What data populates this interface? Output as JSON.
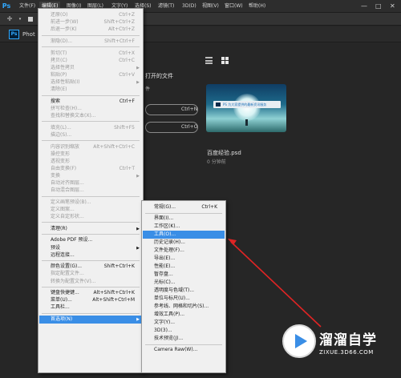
{
  "menubar": {
    "logo": "Ps",
    "items": [
      {
        "label": "文件(F)",
        "active": false
      },
      {
        "label": "编辑(E)",
        "active": true
      },
      {
        "label": "图像(I)",
        "active": false
      },
      {
        "label": "图层(L)",
        "active": false
      },
      {
        "label": "文字(Y)",
        "active": false
      },
      {
        "label": "选择(S)",
        "active": false
      },
      {
        "label": "滤镜(T)",
        "active": false
      },
      {
        "label": "3D(D)",
        "active": false
      },
      {
        "label": "视图(V)",
        "active": false
      },
      {
        "label": "窗口(W)",
        "active": false
      },
      {
        "label": "帮助(H)",
        "active": false
      }
    ],
    "window_controls": [
      "—",
      "□",
      "✕"
    ]
  },
  "tab": {
    "badge": "Ps",
    "label": "Phot"
  },
  "home": {
    "recent_title": "打开的文件",
    "recent_sub": "件",
    "new_shortcut": "Ctrl+N",
    "open_shortcut": "Ctrl+O",
    "file_name": "百度经验.psd",
    "file_time": "0 分钟前",
    "thumb_search_text": "PS 为大家提供的最新资讯服务"
  },
  "edit_menu": {
    "items": [
      {
        "type": "item",
        "label": "还原(O)",
        "shortcut": "Ctrl+Z",
        "disabled": true
      },
      {
        "type": "item",
        "label": "前进一步(W)",
        "shortcut": "Shift+Ctrl+Z",
        "disabled": true
      },
      {
        "type": "item",
        "label": "后退一步(K)",
        "shortcut": "Alt+Ctrl+Z",
        "disabled": true
      },
      {
        "type": "sep"
      },
      {
        "type": "item",
        "label": "渐隐(D)...",
        "shortcut": "Shift+Ctrl+F",
        "disabled": true
      },
      {
        "type": "sep"
      },
      {
        "type": "item",
        "label": "剪切(T)",
        "shortcut": "Ctrl+X",
        "disabled": true
      },
      {
        "type": "item",
        "label": "拷贝(C)",
        "shortcut": "Ctrl+C",
        "disabled": true
      },
      {
        "type": "item",
        "label": "选择性拷贝",
        "shortcut": "",
        "disabled": true,
        "submenu": true
      },
      {
        "type": "item",
        "label": "粘贴(P)",
        "shortcut": "Ctrl+V",
        "disabled": true
      },
      {
        "type": "item",
        "label": "选择性粘贴(I)",
        "shortcut": "",
        "disabled": true,
        "submenu": true
      },
      {
        "type": "item",
        "label": "清除(E)",
        "shortcut": "",
        "disabled": true
      },
      {
        "type": "sep"
      },
      {
        "type": "item",
        "label": "搜索",
        "shortcut": "Ctrl+F",
        "disabled": false
      },
      {
        "type": "item",
        "label": "拼写检查(H)...",
        "shortcut": "",
        "disabled": true
      },
      {
        "type": "item",
        "label": "查找和替换文本(X)...",
        "shortcut": "",
        "disabled": true
      },
      {
        "type": "sep"
      },
      {
        "type": "item",
        "label": "填充(L)...",
        "shortcut": "Shift+F5",
        "disabled": true
      },
      {
        "type": "item",
        "label": "描边(S)...",
        "shortcut": "",
        "disabled": true
      },
      {
        "type": "sep"
      },
      {
        "type": "item",
        "label": "内容识别缩放",
        "shortcut": "Alt+Shift+Ctrl+C",
        "disabled": true
      },
      {
        "type": "item",
        "label": "操控变形",
        "shortcut": "",
        "disabled": true
      },
      {
        "type": "item",
        "label": "透视变形",
        "shortcut": "",
        "disabled": true
      },
      {
        "type": "item",
        "label": "自由变换(F)",
        "shortcut": "Ctrl+T",
        "disabled": true
      },
      {
        "type": "item",
        "label": "变换",
        "shortcut": "",
        "disabled": true,
        "submenu": true
      },
      {
        "type": "item",
        "label": "自动对齐图层...",
        "shortcut": "",
        "disabled": true
      },
      {
        "type": "item",
        "label": "自动混合图层...",
        "shortcut": "",
        "disabled": true
      },
      {
        "type": "sep"
      },
      {
        "type": "item",
        "label": "定义画笔预设(B)...",
        "shortcut": "",
        "disabled": true
      },
      {
        "type": "item",
        "label": "定义图案...",
        "shortcut": "",
        "disabled": true
      },
      {
        "type": "item",
        "label": "定义自定形状...",
        "shortcut": "",
        "disabled": true
      },
      {
        "type": "sep"
      },
      {
        "type": "item",
        "label": "清理(R)",
        "shortcut": "",
        "disabled": false,
        "submenu": true
      },
      {
        "type": "sep"
      },
      {
        "type": "item",
        "label": "Adobe PDF 预设...",
        "shortcut": "",
        "disabled": false
      },
      {
        "type": "item",
        "label": "预设",
        "shortcut": "",
        "disabled": false,
        "submenu": true
      },
      {
        "type": "item",
        "label": "远程连接...",
        "shortcut": "",
        "disabled": false
      },
      {
        "type": "sep"
      },
      {
        "type": "item",
        "label": "颜色设置(G)...",
        "shortcut": "Shift+Ctrl+K",
        "disabled": false
      },
      {
        "type": "item",
        "label": "指定配置文件...",
        "shortcut": "",
        "disabled": true
      },
      {
        "type": "item",
        "label": "转换为配置文件(V)...",
        "shortcut": "",
        "disabled": true
      },
      {
        "type": "sep"
      },
      {
        "type": "item",
        "label": "键盘快捷键...",
        "shortcut": "Alt+Shift+Ctrl+K",
        "disabled": false
      },
      {
        "type": "item",
        "label": "菜单(U)...",
        "shortcut": "Alt+Shift+Ctrl+M",
        "disabled": false
      },
      {
        "type": "item",
        "label": "工具栏...",
        "shortcut": "",
        "disabled": false
      },
      {
        "type": "sep"
      },
      {
        "type": "item",
        "label": "首选项(N)",
        "shortcut": "",
        "disabled": false,
        "submenu": true,
        "highlighted": true
      }
    ]
  },
  "prefs_menu": {
    "items": [
      {
        "type": "item",
        "label": "常规(G)...",
        "shortcut": "Ctrl+K"
      },
      {
        "type": "sep"
      },
      {
        "type": "item",
        "label": "界面(I)..."
      },
      {
        "type": "item",
        "label": "工作区(K)..."
      },
      {
        "type": "item",
        "label": "工具(O)...",
        "highlighted": true
      },
      {
        "type": "item",
        "label": "历史记录(H)..."
      },
      {
        "type": "item",
        "label": "文件处理(F)..."
      },
      {
        "type": "item",
        "label": "导出(E)..."
      },
      {
        "type": "item",
        "label": "性能(E)..."
      },
      {
        "type": "item",
        "label": "暂存盘..."
      },
      {
        "type": "item",
        "label": "光标(C)..."
      },
      {
        "type": "item",
        "label": "透明度与色域(T)..."
      },
      {
        "type": "item",
        "label": "单位与标尺(U)..."
      },
      {
        "type": "item",
        "label": "参考线、网格和切片(S)..."
      },
      {
        "type": "item",
        "label": "增效工具(P)..."
      },
      {
        "type": "item",
        "label": "文字(Y)..."
      },
      {
        "type": "item",
        "label": "3D(3)..."
      },
      {
        "type": "item",
        "label": "技术预览(J)..."
      },
      {
        "type": "sep"
      },
      {
        "type": "item",
        "label": "Camera Raw(W)..."
      }
    ]
  },
  "watermark": {
    "title": "溜溜自学",
    "url": "ZIXUE.3D66.COM"
  },
  "colors": {
    "highlight": "#3a8ee6",
    "arrow": "#e02424",
    "ps_blue": "#31a8ff"
  }
}
